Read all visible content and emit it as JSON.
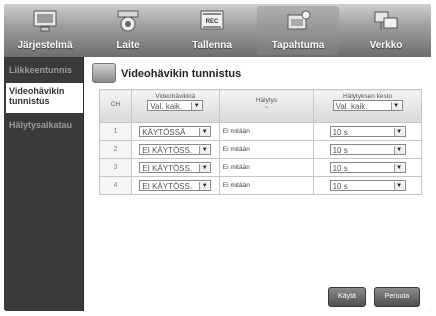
{
  "tabs": [
    {
      "label": "Järjestelmä",
      "icon": "system-icon"
    },
    {
      "label": "Laite",
      "icon": "camera-icon"
    },
    {
      "label": "Tallenna",
      "icon": "record-icon",
      "badge": "REC"
    },
    {
      "label": "Tapahtuma",
      "icon": "event-icon"
    },
    {
      "label": "Verkko",
      "icon": "network-icon"
    }
  ],
  "sidebar": {
    "items": [
      {
        "label": "Liikkeentunnis"
      },
      {
        "label": "Videohävikin tunnistus"
      },
      {
        "label": "Hälytysaikatau"
      }
    ]
  },
  "page": {
    "title": "Videohävikin tunnistus"
  },
  "table": {
    "headers": {
      "ch": "CH",
      "detection": "Videohävikkiä",
      "alarm": "Hälytys",
      "duration": "Hälytyksen kesto"
    },
    "header_selects": {
      "detection": "Val. kaik.",
      "duration": "Val. kaik."
    },
    "rows": [
      {
        "ch": "1",
        "detection": "KÄYTÖSSÄ",
        "alarm": "Ei mitään",
        "duration": "10 s"
      },
      {
        "ch": "2",
        "detection": "EI KÄYTÖSS.",
        "alarm": "Ei mitään",
        "duration": "10 s"
      },
      {
        "ch": "3",
        "detection": "EI KÄYTÖSS.",
        "alarm": "Ei mitään",
        "duration": "10 s"
      },
      {
        "ch": "4",
        "detection": "EI KÄYTÖSS.",
        "alarm": "Ei mitään",
        "duration": "10 s"
      }
    ]
  },
  "buttons": {
    "apply": "Käytä",
    "cancel": "Peruuta"
  },
  "colors": {
    "selected_sidebar_bg": "#ffffff",
    "frame": "#2a2a2a"
  }
}
